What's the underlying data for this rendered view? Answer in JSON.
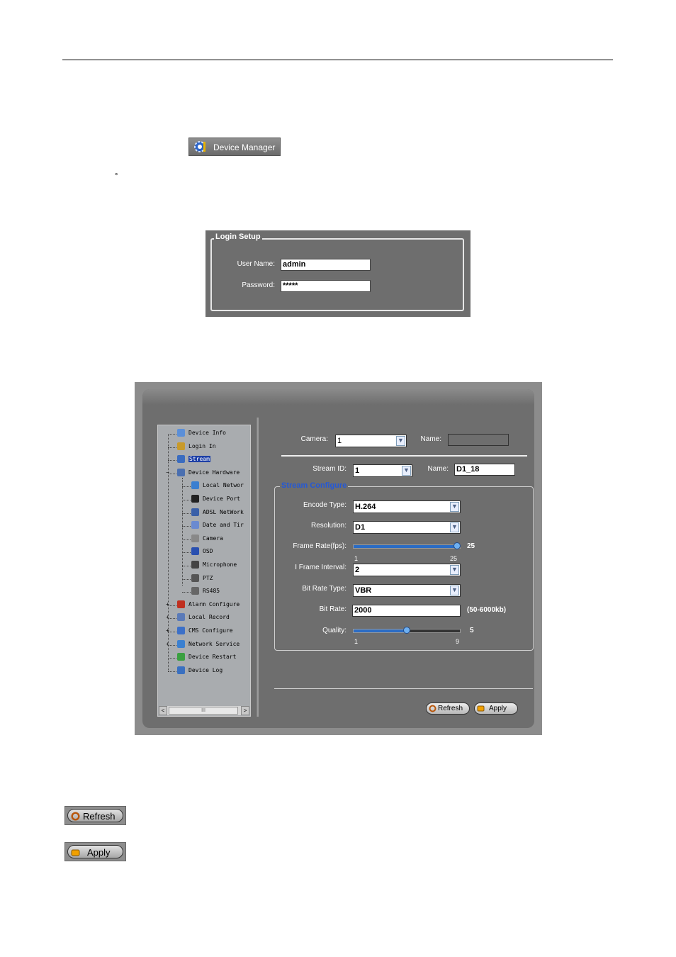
{
  "page": {
    "degree_mark": "°"
  },
  "device_manager_button": {
    "label": "Device Manager",
    "icon": "gear-icon"
  },
  "login_setup": {
    "title": "Login Setup",
    "user_name_label": "User Name:",
    "user_name_value": "admin",
    "password_label": "Password:",
    "password_value": "*****"
  },
  "tree": {
    "items": [
      {
        "label": "Device Info",
        "icon": "document-icon"
      },
      {
        "label": "Login In",
        "icon": "key-icon"
      },
      {
        "label": "Stream",
        "icon": "stream-icon",
        "selected": true
      },
      {
        "label": "Device Hardware",
        "icon": "hardware-icon"
      },
      {
        "label": "Local Networ",
        "icon": "monitor-icon"
      },
      {
        "label": "Device Port",
        "icon": "port-icon"
      },
      {
        "label": "ADSL NetWork",
        "icon": "network-icon"
      },
      {
        "label": "Date and Tir",
        "icon": "calendar-icon"
      },
      {
        "label": "Camera",
        "icon": "camera-icon"
      },
      {
        "label": "OSD",
        "icon": "osd-icon"
      },
      {
        "label": "Microphone",
        "icon": "microphone-icon"
      },
      {
        "label": "PTZ",
        "icon": "ptz-icon"
      },
      {
        "label": "RS485",
        "icon": "rs485-icon"
      },
      {
        "label": "Alarm Configure",
        "icon": "alarm-icon"
      },
      {
        "label": "Local Record",
        "icon": "record-icon"
      },
      {
        "label": "CMS Configure",
        "icon": "cms-icon"
      },
      {
        "label": "Network Service",
        "icon": "service-icon"
      },
      {
        "label": "Device Restart",
        "icon": "restart-icon"
      },
      {
        "label": "Device Log",
        "icon": "log-icon"
      }
    ],
    "scroll_thumb": "III"
  },
  "stream": {
    "camera_label": "Camera:",
    "camera_value": "1",
    "name_label": "Name:",
    "name_value": "",
    "stream_id_label": "Stream ID:",
    "stream_id_value": "1",
    "stream_name_label": "Name:",
    "stream_name_value": "D1_18",
    "group_title": "Stream Configure",
    "encode_type_label": "Encode Type:",
    "encode_type_value": "H.264",
    "resolution_label": "Resolution:",
    "resolution_value": "D1",
    "frame_rate_label": "Frame Rate(fps):",
    "frame_rate_value": "25",
    "frame_rate_min": "1",
    "frame_rate_max": "25",
    "frame_rate_fraction": 1.0,
    "iframe_label": "I Frame Interval:",
    "iframe_value": "2",
    "bit_rate_type_label": "Bit Rate Type:",
    "bit_rate_type_value": "VBR",
    "bit_rate_label": "Bit Rate:",
    "bit_rate_value": "2000",
    "bit_rate_range": "(50-6000kb)",
    "quality_label": "Quality:",
    "quality_value": "5",
    "quality_min": "1",
    "quality_max": "9",
    "quality_fraction": 0.5
  },
  "buttons": {
    "refresh": "Refresh",
    "apply": "Apply"
  }
}
